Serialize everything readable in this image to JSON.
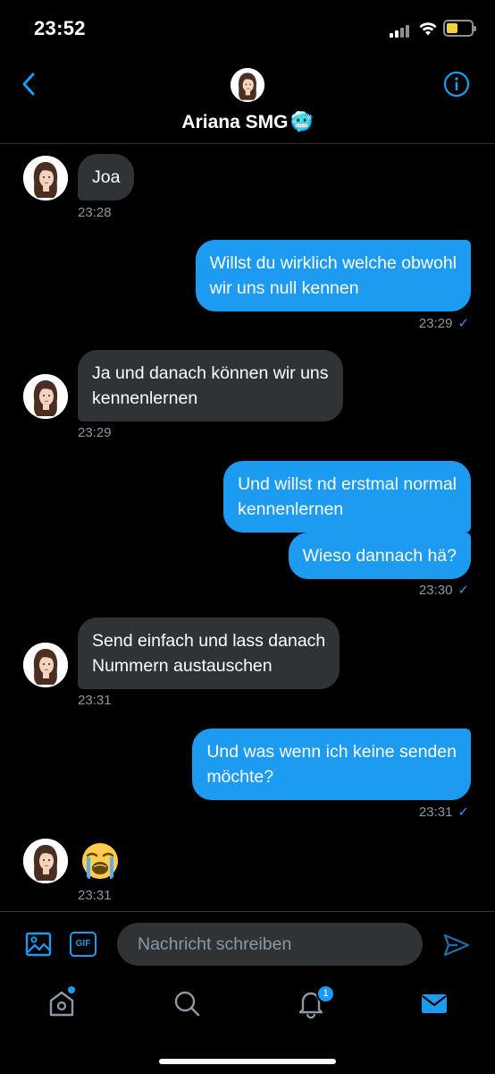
{
  "status_bar": {
    "time": "23:52",
    "battery_color": "#f4d03f"
  },
  "header": {
    "title": "Ariana SMG",
    "title_emoji": "🥶",
    "back_icon": "chevron-left-icon",
    "info_icon": "info-icon",
    "accent": "#1d9bf0"
  },
  "messages": [
    {
      "direction": "in",
      "text_lines": [
        "Joa"
      ],
      "time": "23:28"
    },
    {
      "direction": "out",
      "text_lines": [
        "Willst du wirklich welche obwohl",
        "wir uns null kennen"
      ],
      "time": "23:29",
      "status": "✓"
    },
    {
      "direction": "in",
      "text_lines": [
        "Ja und danach können wir uns",
        "kennenlernen"
      ],
      "time": "23:29"
    },
    {
      "direction": "out",
      "text_lines": [
        "Und willst nd erstmal normal",
        "kennenlernen"
      ]
    },
    {
      "direction": "out",
      "text_lines": [
        "Wieso dannach hä?"
      ],
      "time": "23:30",
      "status": "✓"
    },
    {
      "direction": "in",
      "text_lines": [
        "Send einfach und lass danach",
        "Nummern austauschen"
      ],
      "time": "23:31"
    },
    {
      "direction": "out",
      "text_lines": [
        "Und was wenn ich keine senden",
        "möchte?"
      ],
      "time": "23:31",
      "status": "✓"
    },
    {
      "direction": "in",
      "emoji": "loudly-crying-face",
      "time": "23:31"
    }
  ],
  "composer": {
    "placeholder": "Nachricht schreiben",
    "gif_label": "GIF",
    "media_icon": "image-icon",
    "send_icon": "send-icon"
  },
  "tab_bar": {
    "items": [
      "home-icon",
      "search-icon",
      "bell-icon",
      "mail-icon"
    ],
    "notifications_badge": "1",
    "active": "mail-icon"
  }
}
